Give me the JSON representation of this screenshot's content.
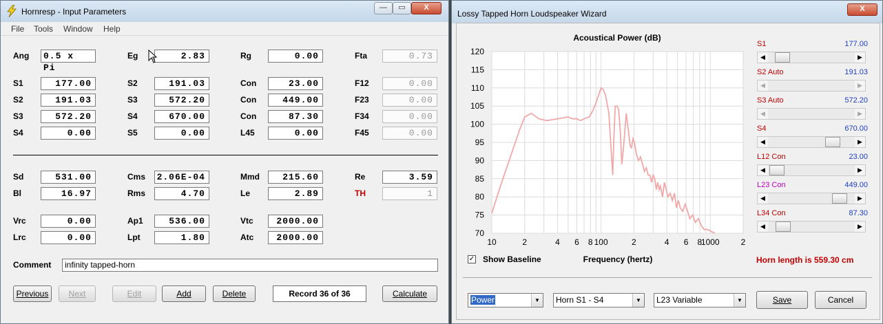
{
  "main_window": {
    "title": "Hornresp - Input Parameters",
    "menu": [
      "File",
      "Tools",
      "Window",
      "Help"
    ],
    "fields": {
      "ang": {
        "label": "Ang",
        "value": "0.5 x Pi"
      },
      "eg": {
        "label": "Eg",
        "value": "2.83"
      },
      "rg": {
        "label": "Rg",
        "value": "0.00"
      },
      "fta": {
        "label": "Fta",
        "value": "0.73"
      },
      "s1": {
        "label": "S1",
        "value": "177.00"
      },
      "s2": {
        "label": "S2",
        "value": "191.03"
      },
      "con1": {
        "label": "Con",
        "value": "23.00"
      },
      "f12": {
        "label": "F12",
        "value": "0.00"
      },
      "s2b": {
        "label": "S2",
        "value": "191.03"
      },
      "s3": {
        "label": "S3",
        "value": "572.20"
      },
      "con2": {
        "label": "Con",
        "value": "449.00"
      },
      "f23": {
        "label": "F23",
        "value": "0.00"
      },
      "s3b": {
        "label": "S3",
        "value": "572.20"
      },
      "s4": {
        "label": "S4",
        "value": "670.00"
      },
      "con3": {
        "label": "Con",
        "value": "87.30"
      },
      "f34": {
        "label": "F34",
        "value": "0.00"
      },
      "s4b": {
        "label": "S4",
        "value": "0.00"
      },
      "s5": {
        "label": "S5",
        "value": "0.00"
      },
      "l45": {
        "label": "L45",
        "value": "0.00"
      },
      "f45": {
        "label": "F45",
        "value": "0.00"
      },
      "sd": {
        "label": "Sd",
        "value": "531.00"
      },
      "cms": {
        "label": "Cms",
        "value": "2.06E-04"
      },
      "mmd": {
        "label": "Mmd",
        "value": "215.60"
      },
      "re": {
        "label": "Re",
        "value": "3.59"
      },
      "bl": {
        "label": "Bl",
        "value": "16.97"
      },
      "rms": {
        "label": "Rms",
        "value": "4.70"
      },
      "le": {
        "label": "Le",
        "value": "2.89"
      },
      "th": {
        "label": "TH",
        "value": "1"
      },
      "vrc": {
        "label": "Vrc",
        "value": "0.00"
      },
      "ap1": {
        "label": "Ap1",
        "value": "536.00"
      },
      "vtc": {
        "label": "Vtc",
        "value": "2000.00"
      },
      "lrc": {
        "label": "Lrc",
        "value": "0.00"
      },
      "lpt": {
        "label": "Lpt",
        "value": "1.80"
      },
      "atc": {
        "label": "Atc",
        "value": "2000.00"
      }
    },
    "comment_label": "Comment",
    "comment_value": "infinity tapped-horn",
    "buttons": {
      "previous": "Previous",
      "next": "Next",
      "edit": "Edit",
      "add": "Add",
      "delete": "Delete",
      "calculate": "Calculate"
    },
    "record": "Record 36 of 36",
    "window_buttons": {
      "min": "—",
      "max": "▭",
      "close": "X"
    }
  },
  "wizard": {
    "title": "Lossy Tapped Horn Loudspeaker Wizard",
    "close": "X",
    "show_baseline_label": "Show Baseline",
    "show_baseline_checked": true,
    "horn_length": "Horn length is 559.30 cm",
    "sliders": [
      {
        "name": "S1",
        "value": "177.00",
        "pos": 0.1,
        "enabled": true,
        "color": "red"
      },
      {
        "name": "S2 Auto",
        "value": "191.03",
        "pos": null,
        "enabled": false,
        "color": "red"
      },
      {
        "name": "S3 Auto",
        "value": "572.20",
        "pos": null,
        "enabled": false,
        "color": "red"
      },
      {
        "name": "S4",
        "value": "670.00",
        "pos": 0.8,
        "enabled": true,
        "color": "red"
      },
      {
        "name": "L12 Con",
        "value": "23.00",
        "pos": 0.02,
        "enabled": true,
        "color": "red"
      },
      {
        "name": "L23 Con",
        "value": "449.00",
        "pos": 0.89,
        "enabled": true,
        "color": "magenta"
      },
      {
        "name": "L34 Con",
        "value": "87.30",
        "pos": 0.11,
        "enabled": true,
        "color": "red"
      }
    ],
    "selects": {
      "mode": "Power",
      "horn": "Horn S1 - S4",
      "variable": "L23 Variable"
    },
    "buttons": {
      "save": "Save",
      "cancel": "Cancel"
    }
  },
  "chart_data": {
    "type": "line",
    "title": "Acoustical Power (dB)",
    "xlabel": "Frequency (hertz)",
    "ylabel": "",
    "x_scale": "log",
    "xlim": [
      10,
      2000
    ],
    "ylim": [
      70,
      120
    ],
    "yticks": [
      70,
      75,
      80,
      85,
      90,
      95,
      100,
      105,
      110,
      115,
      120
    ],
    "xtick_labels": [
      "10",
      "2",
      "4",
      "6",
      "8",
      "100",
      "2",
      "4",
      "6",
      "8",
      "1000",
      "2"
    ],
    "grid": true,
    "series": [
      {
        "color": "#f0a8a8",
        "x": [
          10,
          12,
          15,
          18,
          20,
          23,
          27,
          32,
          40,
          50,
          55,
          60,
          65,
          70,
          78,
          85,
          90,
          95,
          100,
          105,
          110,
          118,
          122,
          125,
          128,
          131,
          135,
          140,
          145,
          150,
          155,
          160,
          165,
          170,
          175,
          180,
          185,
          190,
          196,
          202,
          210,
          220,
          230,
          240,
          250,
          260,
          270,
          280,
          290,
          300,
          310,
          320,
          330,
          340,
          350,
          365,
          380,
          395,
          410,
          430,
          450,
          470,
          490,
          510,
          530,
          560,
          590,
          620,
          650,
          690,
          730,
          780,
          830,
          880,
          950,
          1020,
          1100
        ],
        "y": [
          75.5,
          83,
          91.5,
          98.5,
          102,
          103,
          101.5,
          101,
          101.5,
          102,
          101.5,
          101.5,
          101,
          101.5,
          102,
          104,
          106,
          108,
          110,
          109.5,
          108,
          103,
          96,
          91,
          86,
          96,
          105,
          105,
          104,
          98,
          89,
          93,
          98,
          103,
          100,
          97,
          94,
          93.5,
          96,
          95,
          92,
          90,
          91,
          89,
          87,
          88,
          86,
          86,
          84,
          86,
          85,
          82,
          84,
          82,
          83,
          80,
          84,
          82,
          80,
          81,
          79,
          81,
          77,
          79,
          77,
          76,
          78,
          76,
          74,
          75,
          73,
          74,
          72,
          71,
          71,
          70.5,
          70
        ]
      }
    ]
  }
}
